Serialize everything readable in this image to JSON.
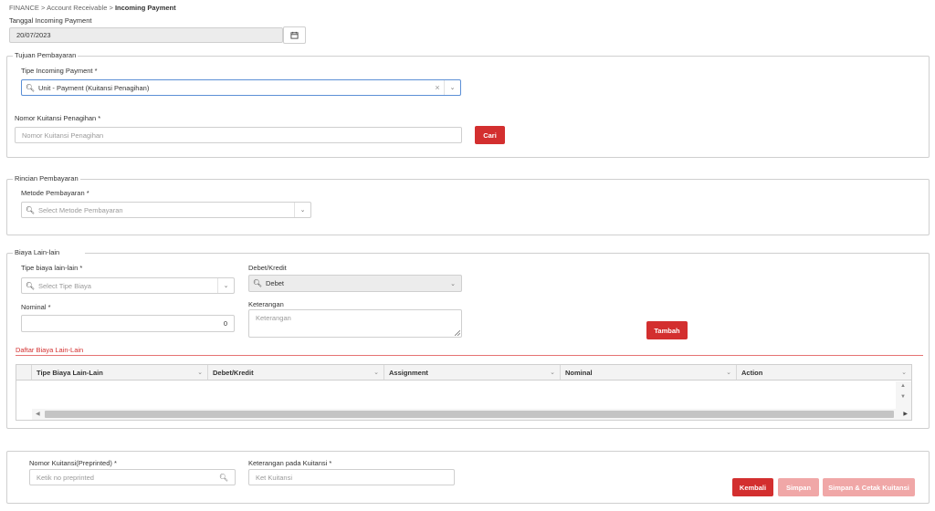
{
  "breadcrumb": {
    "items": [
      "FINANCE",
      "Account Receivable",
      "Incoming Payment"
    ],
    "separator": ">"
  },
  "tanggal": {
    "label": "Tanggal Incoming Payment",
    "value": "20/07/2023"
  },
  "tujuan": {
    "legend": "Tujuan Pembayaran",
    "tipe_label": "Tipe Incoming Payment *",
    "tipe_value": "Unit - Payment (Kuitansi Penagihan)",
    "clear": "×",
    "nomor_label": "Nomor Kuitansi Penagihan *",
    "nomor_placeholder": "Nomor Kuitansi Penagihan",
    "cari": "Cari"
  },
  "rincian": {
    "legend": "Rincian Pembayaran",
    "metode_label": "Metode Pembayaran *",
    "metode_placeholder": "Select Metode Pembayaran"
  },
  "biaya": {
    "legend": "Biaya Lain-lain",
    "tipe_label": "Tipe biaya lain-lain *",
    "tipe_placeholder": "Select Tipe Biaya",
    "debet_label": "Debet/Kredit",
    "debet_value": "Debet",
    "nominal_label": "Nominal *",
    "nominal_value": "0",
    "keterangan_label": "Keterangan",
    "keterangan_placeholder": "Keterangan",
    "tambah": "Tambah",
    "daftar_title": "Daftar Biaya Lain-Lain",
    "columns": [
      "Tipe Biaya Lain-Lain",
      "Debet/Kredit",
      "Assignment",
      "Nominal",
      "Action"
    ]
  },
  "kuitansi": {
    "nomor_label": "Nomor Kuitansi(Preprinted) *",
    "nomor_placeholder": "Ketik no preprinted",
    "ket_label": "Keterangan pada Kuitansi *",
    "ket_placeholder": "Ket Kuitansi"
  },
  "actions": {
    "kembali": "Kembali",
    "simpan": "Simpan",
    "simpan_cetak": "Simpan & Cetak Kuitansi"
  },
  "colors": {
    "primary_red": "#d32f2f",
    "disabled_red": "#f0a7a7",
    "border": "#cfcfcf"
  }
}
